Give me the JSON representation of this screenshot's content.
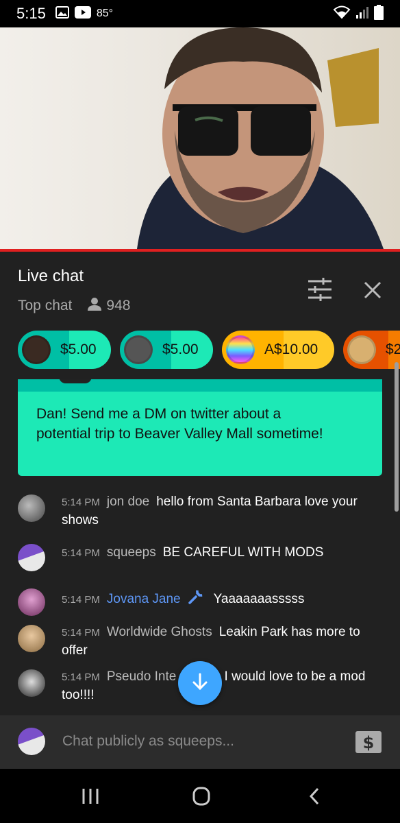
{
  "status_bar": {
    "time": "5:15",
    "temperature": "85°"
  },
  "chat_header": {
    "title": "Live chat",
    "mode": "Top chat",
    "viewer_count": "948"
  },
  "tickers": [
    {
      "amount": "$5.00",
      "color": "#1de9b6",
      "band": "#00bfa5"
    },
    {
      "amount": "$5.00",
      "color": "#1de9b6",
      "band": "#00bfa5"
    },
    {
      "amount": "A$10.00",
      "color": "#ffca28",
      "band": "#ffb300"
    },
    {
      "amount": "$2",
      "color": "#f57c00",
      "band": "#e65100"
    }
  ],
  "super_chat": {
    "message": "Dan! Send me a DM on twitter about a potential trip to Beaver Valley Mall sometime!",
    "color": "#1de9b6"
  },
  "messages": [
    {
      "time": "5:14 PM",
      "author": "jon doe",
      "text": "hello from Santa Barbara love your shows"
    },
    {
      "time": "5:14 PM",
      "author": "squeeps",
      "text": "BE CAREFUL WITH MODS"
    },
    {
      "time": "5:14 PM",
      "author": "Jovana Jane",
      "text": "Yaaaaaaasssss",
      "moderator": true
    },
    {
      "time": "5:14 PM",
      "author": "Worldwide Ghosts",
      "text": "Leakin Park has more to offer"
    },
    {
      "time": "5:14 PM",
      "author": "Pseudo Inte",
      "author_tail": "l",
      "text": "I would love to be a mod too!!!!"
    }
  ],
  "input": {
    "placeholder": "Chat publicly as squeeps..."
  },
  "colors": {
    "accent_blue": "#3ea6ff",
    "progress_red": "#e02020",
    "moderator_blue": "#5e97f6"
  },
  "icons": [
    "gallery-icon",
    "youtube-icon",
    "wifi-icon",
    "signal-icon",
    "battery-icon",
    "person-icon",
    "filter-icon",
    "close-icon",
    "arrow-down-icon",
    "dollar-icon",
    "wrench-icon",
    "recents-icon",
    "home-icon",
    "back-icon"
  ]
}
